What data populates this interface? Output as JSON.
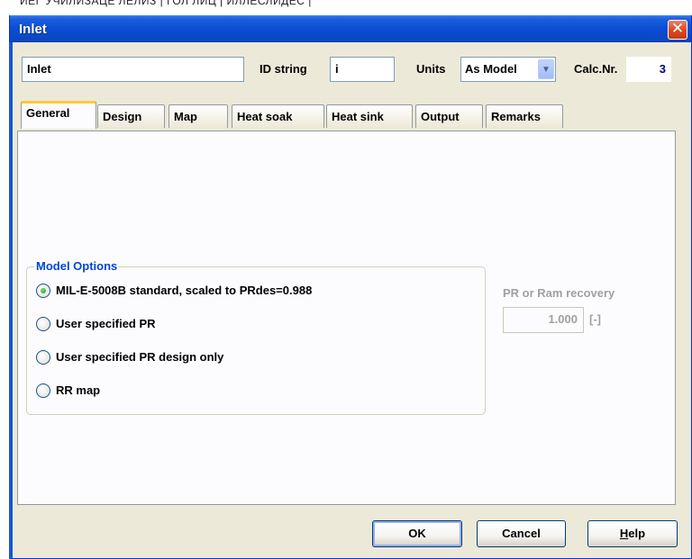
{
  "behind_window_text": "ИЕГ УЧИЛИЗАЦЕ ЛЕЛИЗ | ГОЛ ЛИЦ | ИЛЛЕСЛИДЕС |",
  "window": {
    "title": "Inlet",
    "close_glyph": "✕"
  },
  "header": {
    "name_value": "Inlet",
    "id_string_label": "ID string",
    "id_string_value": "i",
    "units_label": "Units",
    "units_selected": "As Model",
    "calc_label": "Calc.Nr.",
    "calc_value": "3"
  },
  "tabs": [
    {
      "label": "General",
      "active": true
    },
    {
      "label": "Design"
    },
    {
      "label": "Map"
    },
    {
      "label": "Heat soak"
    },
    {
      "label": "Heat sink"
    },
    {
      "label": "Output"
    },
    {
      "label": "Remarks"
    }
  ],
  "model_options": {
    "title": "Model Options",
    "options": [
      {
        "label": "MIL-E-5008B standard, scaled to PRdes=0.988",
        "selected": true
      },
      {
        "label": "User specified PR",
        "selected": false
      },
      {
        "label": "User specified PR design only",
        "selected": false
      },
      {
        "label": "RR map",
        "selected": false
      }
    ]
  },
  "pr_recovery": {
    "label": "PR or Ram recovery",
    "value": "1.000",
    "unit": "[-]",
    "enabled": false
  },
  "buttons": {
    "ok": "OK",
    "cancel": "Cancel",
    "help_first": "H",
    "help_rest": "elp"
  },
  "colors": {
    "titlebar": "#0a49c7",
    "dialog_bg": "#ece9d8",
    "group_title": "#0046d5",
    "disabled_text": "#a0a0a0",
    "active_tab_accent": "#ffc83c"
  }
}
